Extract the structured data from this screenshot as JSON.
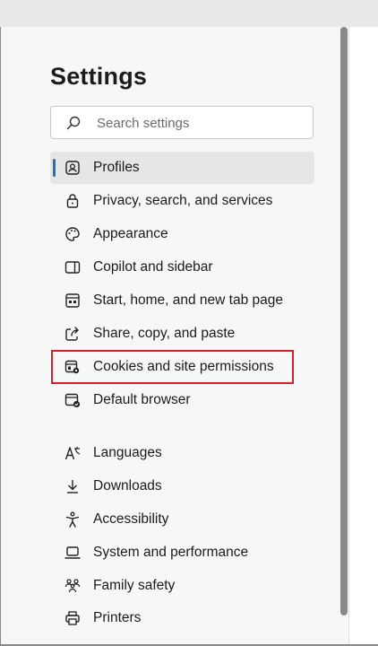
{
  "page": {
    "title": "Settings"
  },
  "search": {
    "placeholder": "Search settings",
    "icon": "search-icon"
  },
  "nav": {
    "items": [
      {
        "label": "Profiles",
        "icon": "profile-icon",
        "selected": true
      },
      {
        "label": "Privacy, search, and services",
        "icon": "lock-icon"
      },
      {
        "label": "Appearance",
        "icon": "palette-icon"
      },
      {
        "label": "Copilot and sidebar",
        "icon": "sidebar-icon"
      },
      {
        "label": "Start, home, and new tab page",
        "icon": "home-page-icon"
      },
      {
        "label": "Share, copy, and paste",
        "icon": "share-icon"
      },
      {
        "label": "Cookies and site permissions",
        "icon": "cookies-permissions-icon",
        "highlighted": true
      },
      {
        "label": "Default browser",
        "icon": "default-browser-icon"
      },
      {
        "label": "Languages",
        "icon": "languages-icon"
      },
      {
        "label": "Downloads",
        "icon": "download-icon"
      },
      {
        "label": "Accessibility",
        "icon": "accessibility-icon"
      },
      {
        "label": "System and performance",
        "icon": "laptop-icon"
      },
      {
        "label": "Family safety",
        "icon": "family-icon"
      },
      {
        "label": "Printers",
        "icon": "printer-icon"
      }
    ]
  },
  "colors": {
    "accent": "#1a73c8",
    "highlight_border": "#d0202d",
    "selected_bg": "#e6e6e6",
    "panel_bg": "#f7f7f7"
  }
}
